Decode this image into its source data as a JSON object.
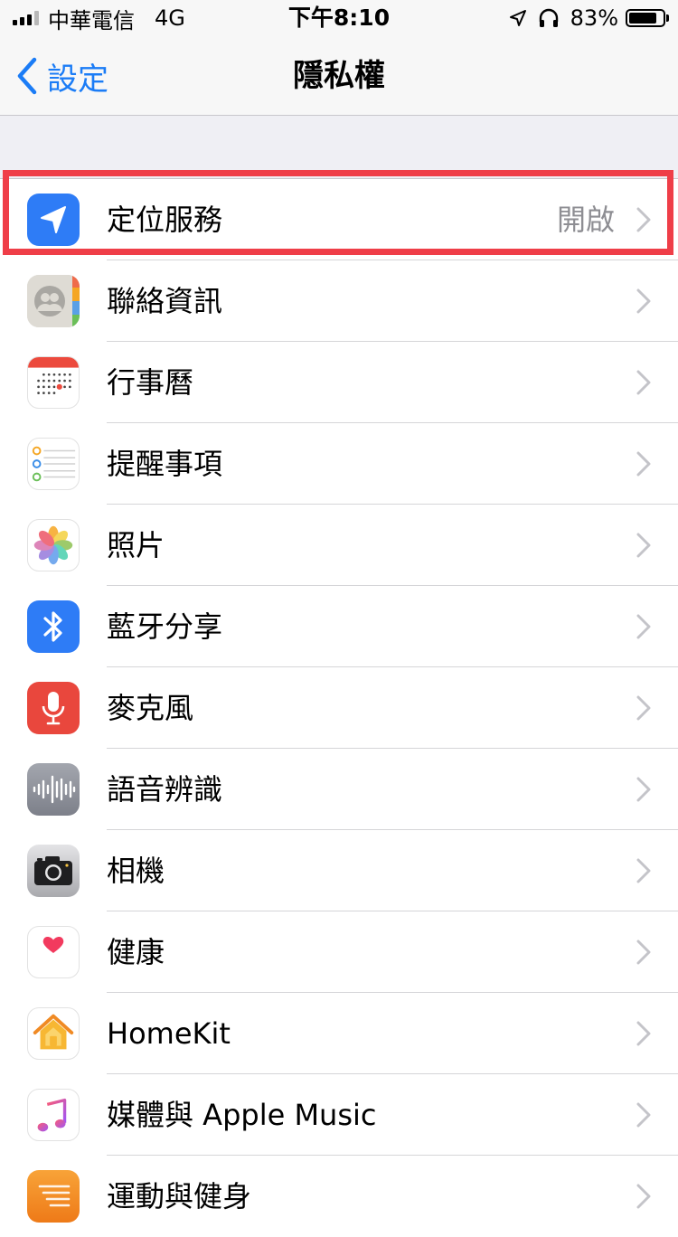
{
  "status_bar": {
    "carrier": "中華電信",
    "network": "4G",
    "time": "下午8:10",
    "battery": "83%",
    "battery_level": 0.83
  },
  "nav": {
    "back_label": "設定",
    "title": "隱私權"
  },
  "colors": {
    "accent": "#1b7cf6",
    "highlight": "#ef3e48",
    "location_icon_bg": "#2e7cf6",
    "bluetooth_icon_bg": "#2e7cf6",
    "microphone_icon_bg": "#e9473d"
  },
  "rows": [
    {
      "label": "定位服務",
      "value": "開啟",
      "icon": "location-arrow-icon",
      "highlighted": true
    },
    {
      "label": "聯絡資訊",
      "value": "",
      "icon": "contacts-icon"
    },
    {
      "label": "行事曆",
      "value": "",
      "icon": "calendar-icon"
    },
    {
      "label": "提醒事項",
      "value": "",
      "icon": "reminders-icon"
    },
    {
      "label": "照片",
      "value": "",
      "icon": "photos-icon"
    },
    {
      "label": "藍牙分享",
      "value": "",
      "icon": "bluetooth-icon"
    },
    {
      "label": "麥克風",
      "value": "",
      "icon": "microphone-icon"
    },
    {
      "label": "語音辨識",
      "value": "",
      "icon": "speech-recognition-icon"
    },
    {
      "label": "相機",
      "value": "",
      "icon": "camera-icon"
    },
    {
      "label": "健康",
      "value": "",
      "icon": "health-heart-icon"
    },
    {
      "label": "HomeKit",
      "value": "",
      "icon": "homekit-house-icon"
    },
    {
      "label": "媒體與 Apple Music",
      "value": "",
      "icon": "music-note-icon"
    },
    {
      "label": "運動與健身",
      "value": "",
      "icon": "motion-fitness-icon"
    }
  ]
}
